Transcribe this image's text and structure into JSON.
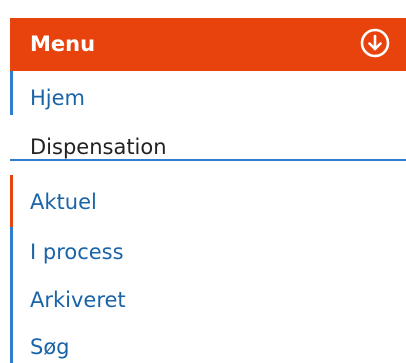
{
  "menu": {
    "title": "Menu",
    "toggle_icon": "circle-arrow-down-icon",
    "header_color": "#e8430c",
    "items": [
      {
        "label": "Hjem",
        "kind": "link"
      },
      {
        "label": "Dispensation",
        "kind": "section"
      },
      {
        "label": "Aktuel",
        "kind": "link",
        "active": true
      },
      {
        "label": "I process",
        "kind": "link"
      },
      {
        "label": "Arkiveret",
        "kind": "link"
      },
      {
        "label": "Søg",
        "kind": "link"
      }
    ],
    "link_color": "#1a64a8",
    "accent_color": "#2e7fd1",
    "active_color": "#e8430c"
  }
}
